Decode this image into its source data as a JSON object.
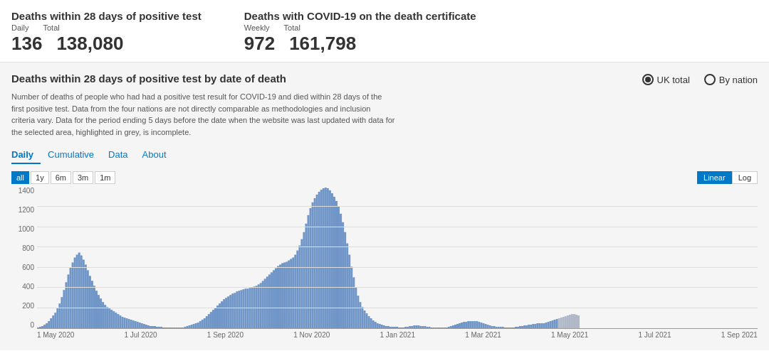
{
  "topStats": [
    {
      "title": "Deaths within 28 days of positive test",
      "labels": [
        "Daily",
        "Total"
      ],
      "values": [
        "136",
        "138,080"
      ]
    },
    {
      "title": "Deaths with COVID-19 on the death certificate",
      "labels": [
        "Weekly",
        "Total"
      ],
      "values": [
        "972",
        "161,798"
      ]
    }
  ],
  "chartSection": {
    "title": "Deaths within 28 days of positive test by date of death",
    "radioOptions": [
      {
        "label": "UK total",
        "selected": true
      },
      {
        "label": "By nation",
        "selected": false
      }
    ],
    "description": "Number of deaths of people who had had a positive test result for COVID-19 and died within 28 days of the first positive test. Data from the four nations are not directly comparable as methodologies and inclusion criteria vary. Data for the period ending 5 days before the date when the website was last updated with data for the selected area, highlighted in grey, is incomplete.",
    "tabs": [
      "Daily",
      "Cumulative",
      "Data",
      "About"
    ],
    "activeTab": "Daily",
    "timeButtons": [
      "all",
      "1y",
      "6m",
      "3m",
      "1m"
    ],
    "activeTimeBtn": "all",
    "scaleButtons": [
      "Linear",
      "Log"
    ],
    "activeScaleBtn": "Linear",
    "yAxisLabels": [
      "1400",
      "1200",
      "1000",
      "800",
      "600",
      "400",
      "200",
      "0"
    ],
    "xAxisLabels": [
      "1 May 2020",
      "1 Jul 2020",
      "1 Sep 2020",
      "1 Nov 2020",
      "1 Jan 2021",
      "1 Mar 2021",
      "1 May 2021",
      "1 Jul 2021",
      "1 Sep 2021"
    ]
  }
}
